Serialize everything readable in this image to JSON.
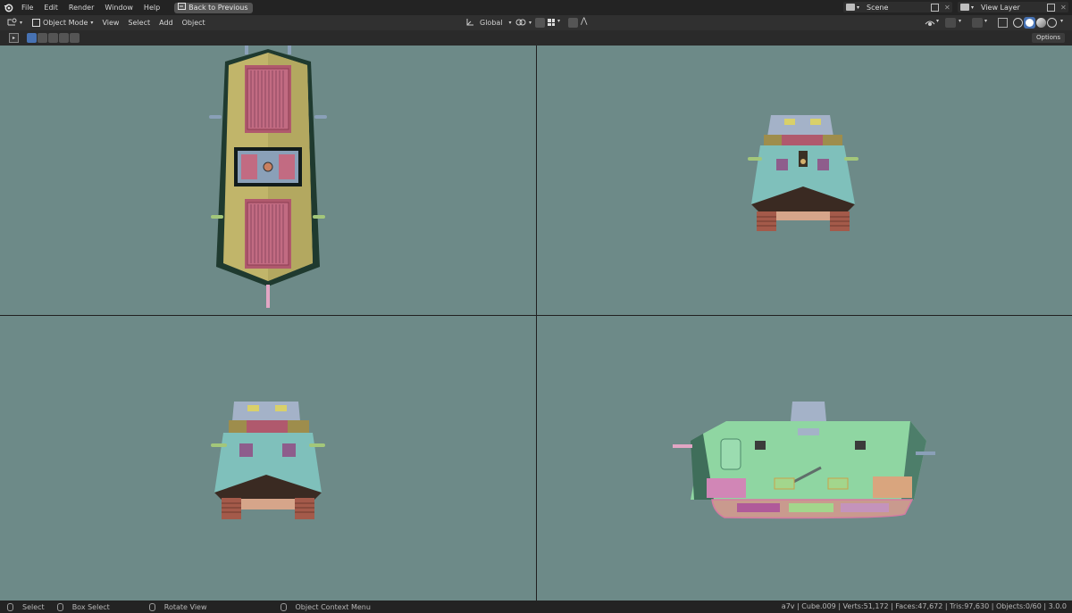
{
  "menu": {
    "items": [
      "File",
      "Edit",
      "Render",
      "Window",
      "Help"
    ],
    "back_button": "Back to Previous"
  },
  "scene": {
    "name": "Scene",
    "view_layer": "View Layer"
  },
  "header": {
    "mode": "Object Mode",
    "menus": [
      "View",
      "Select",
      "Add",
      "Object"
    ],
    "orientation": "Global",
    "options_label": "Options"
  },
  "status": {
    "select": "Select",
    "box_select": "Box Select",
    "rotate_view": "Rotate View",
    "context_menu": "Object Context Menu",
    "stats": "a7v | Cube.009 | Verts:51,172 | Faces:47,672 | Tris:97,630 | Objects:0/60 | 3.0.0"
  },
  "colors": {
    "viewport_bg": "#6d8a88",
    "header_bg": "#303030",
    "topbar_bg": "#232323",
    "accent": "#4772b3"
  }
}
